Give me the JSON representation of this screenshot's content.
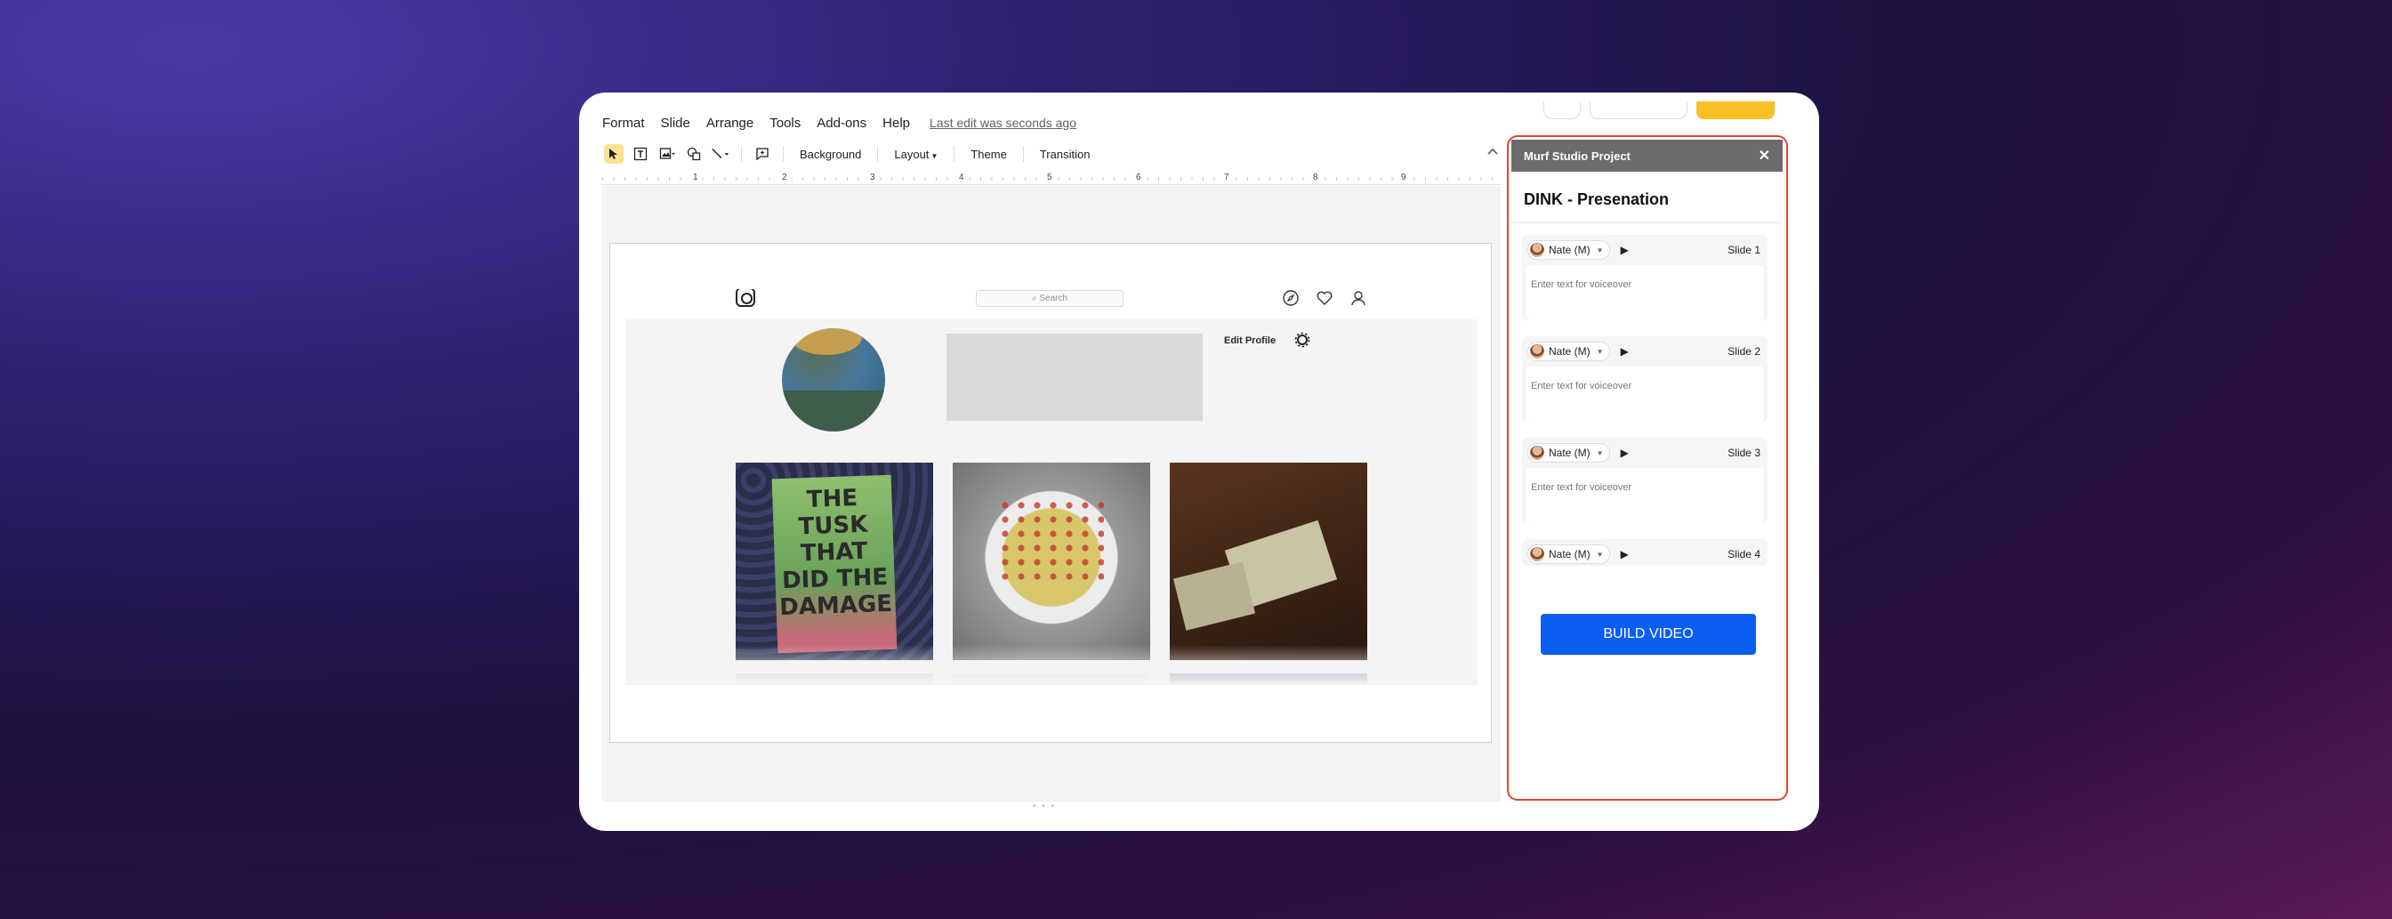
{
  "menu": {
    "items": [
      "Format",
      "Slide",
      "Arrange",
      "Tools",
      "Add-ons",
      "Help"
    ],
    "last_edit": "Last edit was seconds ago"
  },
  "toolbar": {
    "background": "Background",
    "layout": "Layout",
    "theme": "Theme",
    "transition": "Transition"
  },
  "ruler": {
    "numbers": [
      "1",
      "2",
      "3",
      "4",
      "5",
      "6",
      "7",
      "8",
      "9"
    ]
  },
  "slide_content": {
    "search_placeholder": "Search",
    "edit_profile": "Edit Profile",
    "book_title": "THE TUSK THAT DID THE DAMAGE"
  },
  "panel": {
    "header_title": "Murf Studio Project",
    "close": "✕",
    "project_title": "DINK - Presenation",
    "voice_name": "Nate (M)",
    "voiceover_placeholder": "Enter text for voiceover",
    "slides": [
      {
        "label": "Slide 1"
      },
      {
        "label": "Slide 2"
      },
      {
        "label": "Slide 3"
      },
      {
        "label": "Slide 4"
      }
    ],
    "build_button": "BUILD VIDEO"
  },
  "colors": {
    "accent_border": "#e0452b",
    "build_button": "#0a5ef2",
    "panel_header": "#6b6b6b",
    "active_tool": "#fde293"
  }
}
